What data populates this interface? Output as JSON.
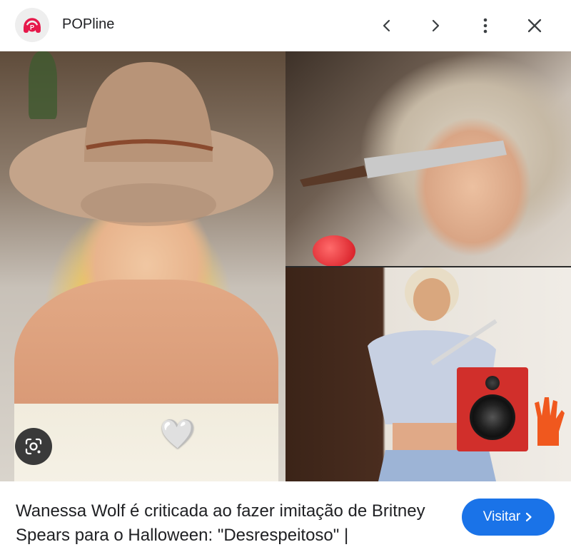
{
  "header": {
    "site_name": "POPline",
    "logo_icon": "popline-headphones-logo",
    "back_icon": "chevron-left-icon",
    "forward_icon": "chevron-right-icon",
    "more_icon": "more-vert-icon",
    "close_icon": "close-icon"
  },
  "image": {
    "overlay_emoji": "🤍",
    "lens_icon": "google-lens-icon"
  },
  "caption": {
    "text": "Wanessa Wolf é criticada ao fazer imitação de Britney Spears para o Halloween: \"Desrespeitoso\" |"
  },
  "visit_button": {
    "label": "Visitar",
    "icon": "chevron-right-icon"
  },
  "colors": {
    "accent": "#1a73e8",
    "logo_red": "#e6194b"
  }
}
